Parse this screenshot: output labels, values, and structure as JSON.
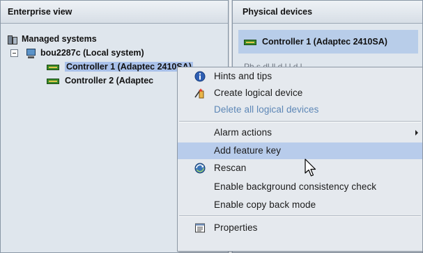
{
  "enterprise_view": {
    "title": "Enterprise view",
    "tree": {
      "root": {
        "label": "Managed systems",
        "icon": "managed-systems-icon"
      },
      "system": {
        "label": "bou2287c (Local system)",
        "icon": "server-icon",
        "expanded": true
      },
      "controllers": [
        {
          "label": "Controller 1 (Adaptec 2410SA)",
          "icon": "controller-icon",
          "selected": true
        },
        {
          "label": "Controller 2 (Adaptec",
          "icon": "controller-icon",
          "selected": false
        }
      ]
    }
  },
  "physical_devices": {
    "title": "Physical devices",
    "selected_device": {
      "label": "Controller 1 (Adaptec 2410SA)",
      "icon": "controller-icon"
    },
    "faded_text": "Ph s  dl  ll  d l l d  l"
  },
  "context_menu": {
    "items": [
      {
        "label": "Hints and tips",
        "icon": "info-icon",
        "enabled": true
      },
      {
        "label": "Create logical device",
        "icon": "wand-icon",
        "enabled": true
      },
      {
        "label": "Delete all logical devices",
        "icon": "",
        "enabled": false
      },
      {
        "label": "Alarm actions",
        "icon": "",
        "enabled": true,
        "submenu": true
      },
      {
        "label": "Add feature key",
        "icon": "",
        "enabled": true,
        "hovered": true
      },
      {
        "label": "Rescan",
        "icon": "rescan-icon",
        "enabled": true
      },
      {
        "label": "Enable background consistency check",
        "icon": "",
        "enabled": true
      },
      {
        "label": "Enable copy back mode",
        "icon": "",
        "enabled": true
      },
      {
        "label": "Properties",
        "icon": "properties-icon",
        "enabled": true
      }
    ]
  },
  "colors": {
    "panel_bg": "#dfe6ed",
    "selection": "#a9c1ea",
    "menu_bg": "#e5e9ee",
    "menu_hover": "#b8cceb",
    "disabled_text": "#5c86b6"
  }
}
